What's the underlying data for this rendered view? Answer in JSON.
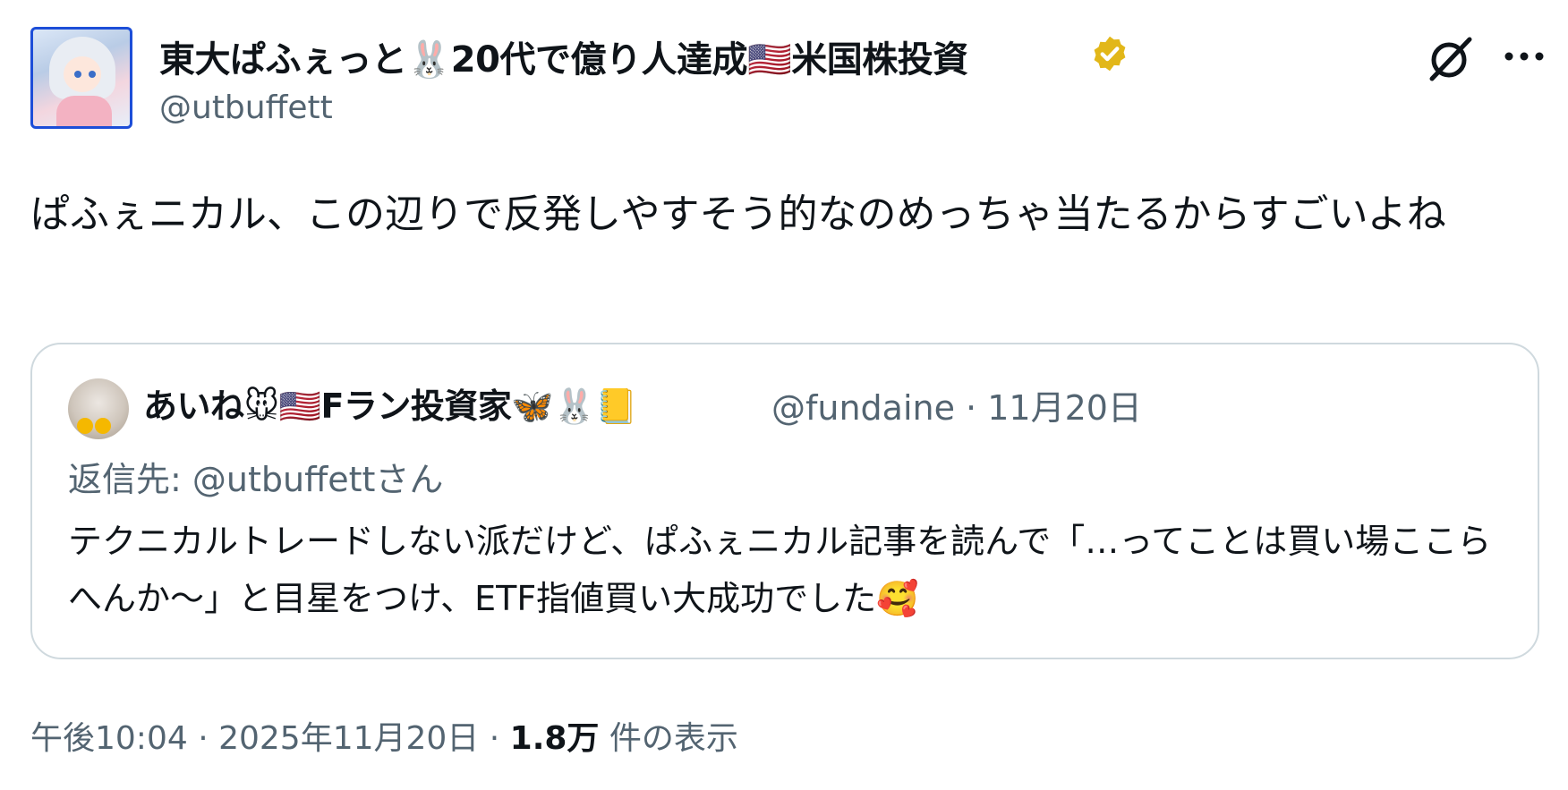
{
  "author": {
    "display_name": "東大ぱふぇっと🐰20代で億り人達成🇺🇸米国株投資",
    "handle": "@utbuffett",
    "verified": true,
    "verified_color": "#e2b719"
  },
  "header_icons": {
    "grok": "grok-icon",
    "more": "more-icon"
  },
  "tweet": {
    "text": "ぱふぇニカル、この辺りで反発しやすそう的なのめっちゃ当たるからすごいよね"
  },
  "quote": {
    "display_name": "あいね🐭🇺🇸Fラン投資家🦋🐰📒",
    "meta": "@fundaine · 11月20日",
    "reply_to": "返信先: @utbuffettさん",
    "text": "テクニカルトレードしない派だけど、ぱふぇニカル記事を読んで「…ってことは買い場ここらへんか～」と目星をつけ、ETF指値買い大成功でした🥰"
  },
  "footer": {
    "time": "午後10:04 · 2025年11月20日 · ",
    "views_count": "1.8万",
    "views_label": " 件の表示"
  },
  "colors": {
    "text": "#0f1419",
    "muted": "#536471",
    "border": "#cfd9de"
  }
}
